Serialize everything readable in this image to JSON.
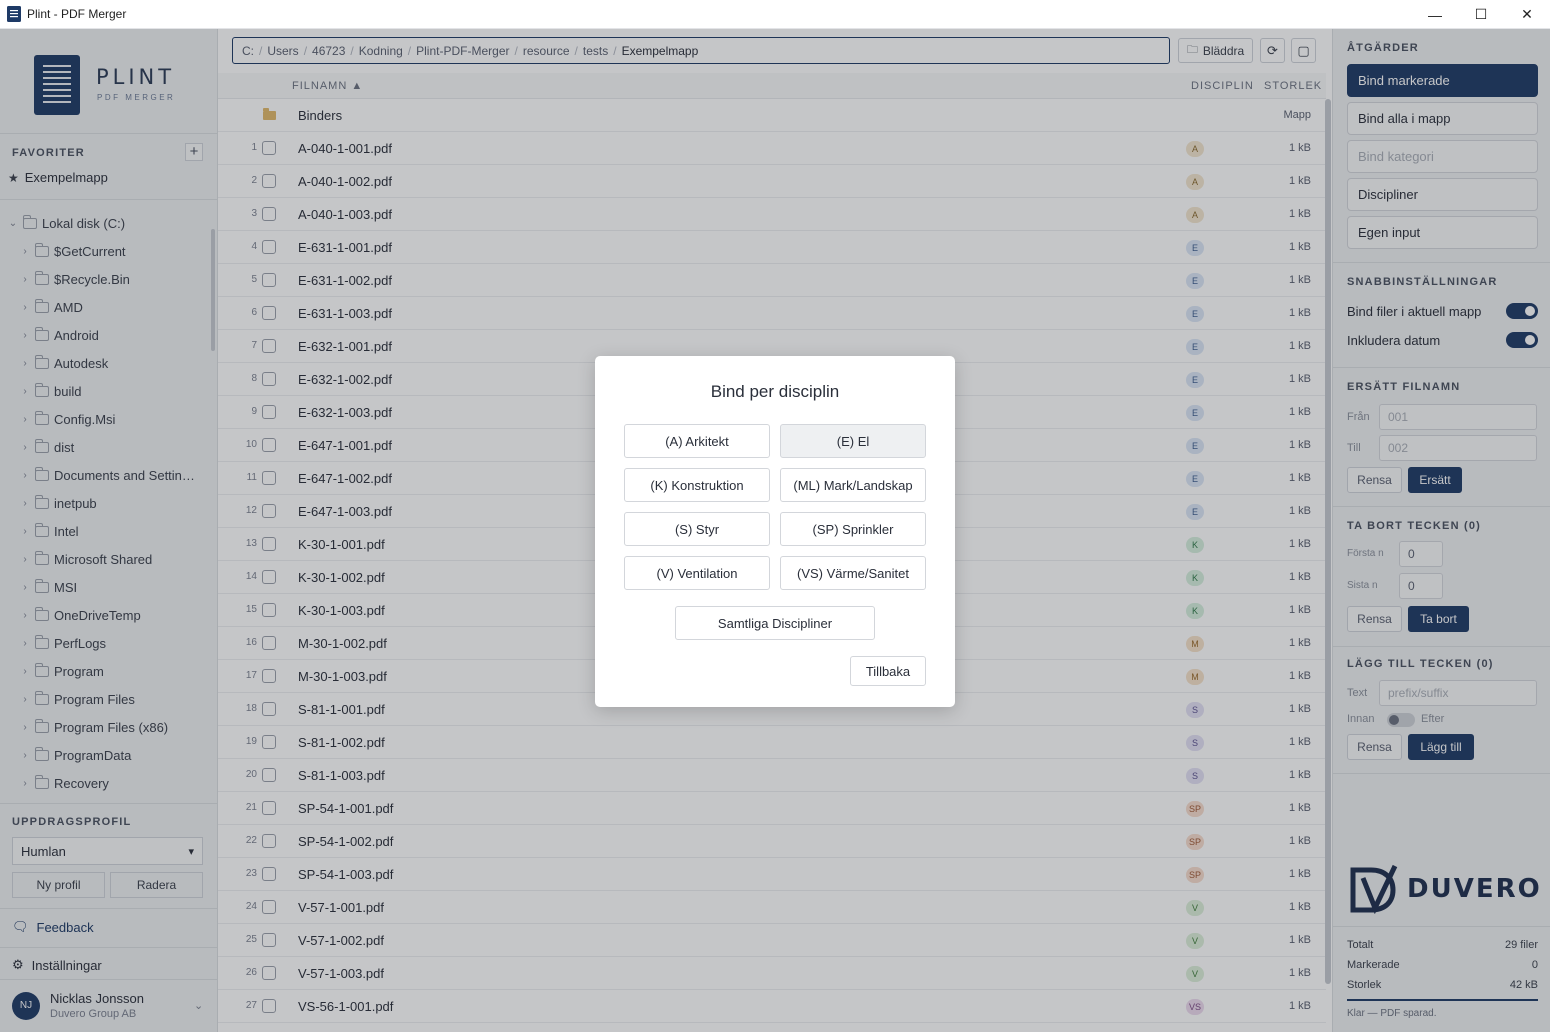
{
  "window": {
    "title": "Plint - PDF Merger",
    "minimize": "—",
    "maximize": "☐",
    "close": "✕"
  },
  "logo": {
    "name": "PLINT",
    "subtitle": "PDF MERGER"
  },
  "sidebar": {
    "favorites_header": "FAVORITER",
    "add_label": "+",
    "favorites": [
      {
        "label": "Exempelmapp"
      }
    ],
    "tree_root": "Lokal disk (C:)",
    "tree_items": [
      "$GetCurrent",
      "$Recycle.Bin",
      "AMD",
      "Android",
      "Autodesk",
      "build",
      "Config.Msi",
      "dist",
      "Documents and Settin…",
      "inetpub",
      "Intel",
      "Microsoft Shared",
      "MSI",
      "OneDriveTemp",
      "PerfLogs",
      "Program",
      "Program Files",
      "Program Files (x86)",
      "ProgramData",
      "Recovery"
    ],
    "profile_header": "UPPDRAGSPROFIL",
    "profile_value": "Humlan",
    "new_profile": "Ny profil",
    "delete_profile": "Radera",
    "feedback": "Feedback",
    "settings": "Inställningar",
    "user": {
      "initials": "NJ",
      "name": "Nicklas Jonsson",
      "org": "Duvero Group AB"
    }
  },
  "path": [
    "C:",
    "Users",
    "46723",
    "Kodning",
    "Plint-PDF-Merger",
    "resource",
    "tests",
    "Exempelmapp"
  ],
  "toolbar": {
    "browse": "Bläddra"
  },
  "table": {
    "col_name": "FILNAMN ▲",
    "col_disc": "DISCIPLIN",
    "col_size": "STORLEK",
    "folder": {
      "name": "Binders",
      "size": "Mapp"
    },
    "files": [
      {
        "n": "1",
        "name": "A-040-1-001.pdf",
        "disc": "A",
        "size": "1 kB"
      },
      {
        "n": "2",
        "name": "A-040-1-002.pdf",
        "disc": "A",
        "size": "1 kB"
      },
      {
        "n": "3",
        "name": "A-040-1-003.pdf",
        "disc": "A",
        "size": "1 kB"
      },
      {
        "n": "4",
        "name": "E-631-1-001.pdf",
        "disc": "E",
        "size": "1 kB"
      },
      {
        "n": "5",
        "name": "E-631-1-002.pdf",
        "disc": "E",
        "size": "1 kB"
      },
      {
        "n": "6",
        "name": "E-631-1-003.pdf",
        "disc": "E",
        "size": "1 kB"
      },
      {
        "n": "7",
        "name": "E-632-1-001.pdf",
        "disc": "E",
        "size": "1 kB"
      },
      {
        "n": "8",
        "name": "E-632-1-002.pdf",
        "disc": "E",
        "size": "1 kB"
      },
      {
        "n": "9",
        "name": "E-632-1-003.pdf",
        "disc": "E",
        "size": "1 kB"
      },
      {
        "n": "10",
        "name": "E-647-1-001.pdf",
        "disc": "E",
        "size": "1 kB"
      },
      {
        "n": "11",
        "name": "E-647-1-002.pdf",
        "disc": "E",
        "size": "1 kB"
      },
      {
        "n": "12",
        "name": "E-647-1-003.pdf",
        "disc": "E",
        "size": "1 kB"
      },
      {
        "n": "13",
        "name": "K-30-1-001.pdf",
        "disc": "K",
        "size": "1 kB"
      },
      {
        "n": "14",
        "name": "K-30-1-002.pdf",
        "disc": "K",
        "size": "1 kB"
      },
      {
        "n": "15",
        "name": "K-30-1-003.pdf",
        "disc": "K",
        "size": "1 kB"
      },
      {
        "n": "16",
        "name": "M-30-1-002.pdf",
        "disc": "M",
        "size": "1 kB"
      },
      {
        "n": "17",
        "name": "M-30-1-003.pdf",
        "disc": "M",
        "size": "1 kB"
      },
      {
        "n": "18",
        "name": "S-81-1-001.pdf",
        "disc": "S",
        "size": "1 kB"
      },
      {
        "n": "19",
        "name": "S-81-1-002.pdf",
        "disc": "S",
        "size": "1 kB"
      },
      {
        "n": "20",
        "name": "S-81-1-003.pdf",
        "disc": "S",
        "size": "1 kB"
      },
      {
        "n": "21",
        "name": "SP-54-1-001.pdf",
        "disc": "SP",
        "size": "1 kB"
      },
      {
        "n": "22",
        "name": "SP-54-1-002.pdf",
        "disc": "SP",
        "size": "1 kB"
      },
      {
        "n": "23",
        "name": "SP-54-1-003.pdf",
        "disc": "SP",
        "size": "1 kB"
      },
      {
        "n": "24",
        "name": "V-57-1-001.pdf",
        "disc": "V",
        "size": "1 kB"
      },
      {
        "n": "25",
        "name": "V-57-1-002.pdf",
        "disc": "V",
        "size": "1 kB"
      },
      {
        "n": "26",
        "name": "V-57-1-003.pdf",
        "disc": "V",
        "size": "1 kB"
      },
      {
        "n": "27",
        "name": "VS-56-1-001.pdf",
        "disc": "VS",
        "size": "1 kB"
      }
    ],
    "badge_colors": {
      "A": {
        "bg": "#f3e6cf",
        "fg": "#8a6a2f"
      },
      "E": {
        "bg": "#dbe6f6",
        "fg": "#3f5f8f"
      },
      "K": {
        "bg": "#d6efdd",
        "fg": "#2f7a4a"
      },
      "M": {
        "bg": "#f6e2c9",
        "fg": "#9a6a2a"
      },
      "S": {
        "bg": "#e3e0f4",
        "fg": "#5b5190"
      },
      "SP": {
        "bg": "#f7dccd",
        "fg": "#a05a36"
      },
      "V": {
        "bg": "#dcefd9",
        "fg": "#3f7d3a"
      },
      "VS": {
        "bg": "#ecd9ee",
        "fg": "#7e4b86"
      }
    }
  },
  "right": {
    "actions_header": "ÅTGÄRDER",
    "bind_selected": "Bind markerade",
    "bind_all": "Bind alla i mapp",
    "bind_category": "Bind kategori",
    "disciplines": "Discipliner",
    "own_input": "Egen input",
    "quick_header": "SNABBINSTÄLLNINGAR",
    "bind_current": "Bind filer i aktuell mapp",
    "include_date": "Inkludera datum",
    "replace_header": "ERSÄTT FILNAMN",
    "from_label": "Från",
    "from_placeholder": "001",
    "to_label": "Till",
    "to_placeholder": "002",
    "clear": "Rensa",
    "replace": "Ersätt",
    "remove_header": "TA BORT TECKEN (0)",
    "first_n": "Första n",
    "last_n": "Sista n",
    "first_value": "0",
    "last_value": "0",
    "remove": "Ta bort",
    "add_header": "LÄGG TILL TECKEN (0)",
    "text_label": "Text",
    "text_placeholder": "prefix/suffix",
    "before": "Innan",
    "after": "Efter",
    "add": "Lägg till",
    "brand": "DUVERO",
    "total_label": "Totalt",
    "total_value": "29 filer",
    "selected_label": "Markerade",
    "selected_value": "0",
    "size_label": "Storlek",
    "size_value": "42 kB",
    "status": "Klar — PDF sparad."
  },
  "modal": {
    "title": "Bind per disciplin",
    "buttons": [
      "(A) Arkitekt",
      "(E) El",
      "(K) Konstruktion",
      "(ML) Mark/Landskap",
      "(S) Styr",
      "(SP) Sprinkler",
      "(V) Ventilation",
      "(VS) Värme/Sanitet"
    ],
    "all": "Samtliga Discipliner",
    "back": "Tillbaka"
  }
}
